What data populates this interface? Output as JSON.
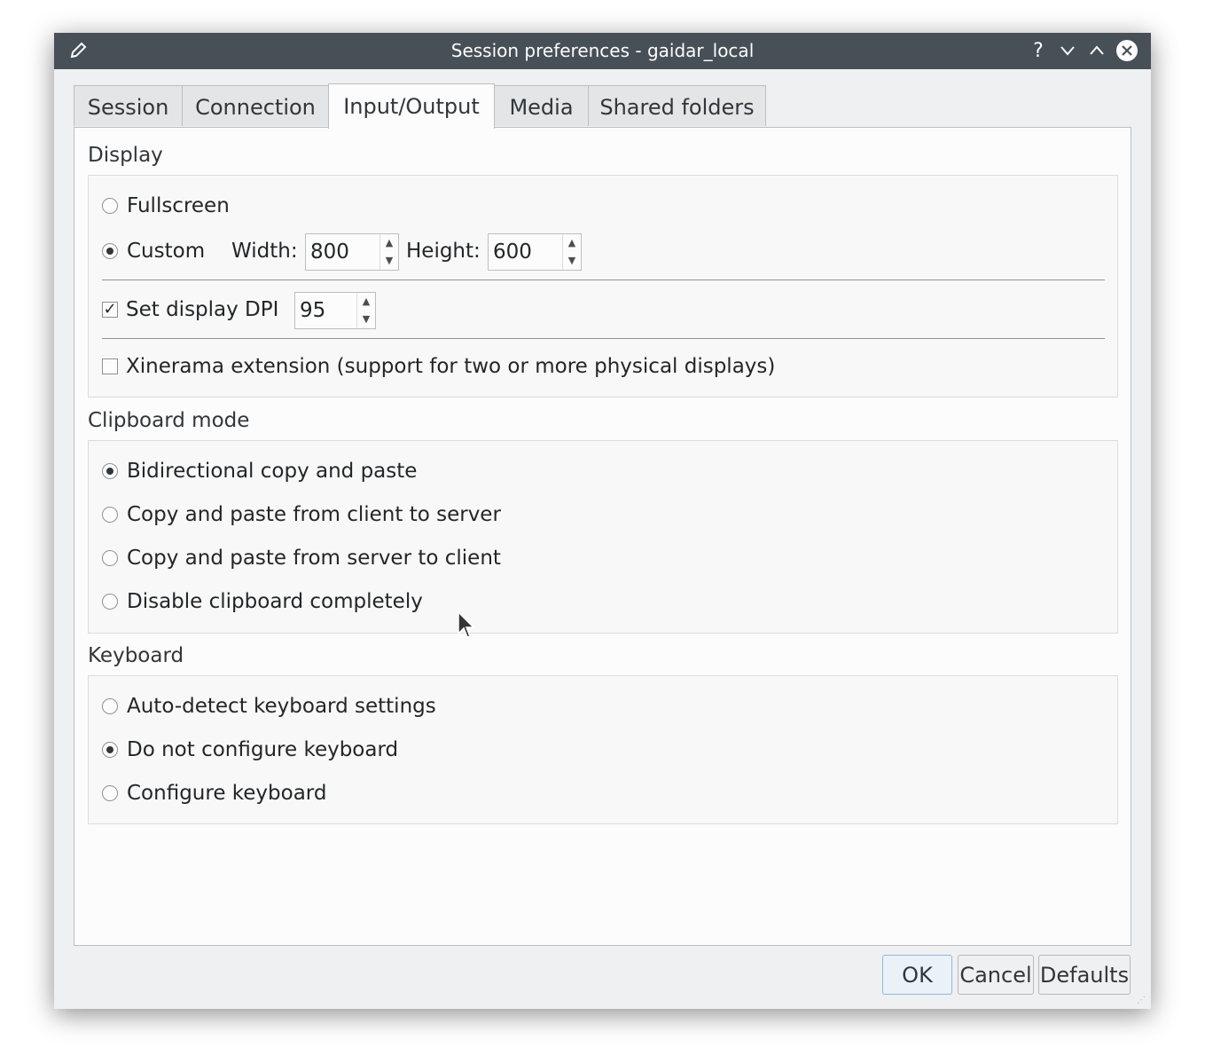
{
  "window": {
    "title": "Session preferences - gaidar_local",
    "edit_icon": "pencil-icon",
    "controls": {
      "help": "?",
      "minimize": "chevron-down-icon",
      "maximize": "chevron-up-icon",
      "close": "close-icon"
    }
  },
  "tabs": [
    {
      "label": "Session",
      "active": false
    },
    {
      "label": "Connection",
      "active": false
    },
    {
      "label": "Input/Output",
      "active": true
    },
    {
      "label": "Media",
      "active": false
    },
    {
      "label": "Shared folders",
      "active": false
    }
  ],
  "display": {
    "title": "Display",
    "fullscreen_label": "Fullscreen",
    "custom_label": "Custom",
    "width_label": "Width:",
    "width_value": "800",
    "height_label": "Height:",
    "height_value": "600",
    "dpi_label": "Set display DPI",
    "dpi_checked": true,
    "dpi_value": "95",
    "xinerama_label": "Xinerama extension (support for two or more physical displays)",
    "xinerama_checked": false,
    "selected": "custom"
  },
  "clipboard": {
    "title": "Clipboard mode",
    "options": [
      "Bidirectional copy and paste",
      "Copy and paste from client to server",
      "Copy and paste from server to client",
      "Disable clipboard completely"
    ],
    "selected_index": 0
  },
  "keyboard": {
    "title": "Keyboard",
    "options": [
      "Auto-detect keyboard settings",
      "Do not configure keyboard",
      "Configure keyboard"
    ],
    "selected_index": 1
  },
  "buttons": {
    "ok": "OK",
    "cancel": "Cancel",
    "defaults": "Defaults"
  },
  "colors": {
    "titlebar": "#475057",
    "panel": "#fcfcfc",
    "window": "#eff0f1",
    "default_button_border": "#8fb8db"
  }
}
